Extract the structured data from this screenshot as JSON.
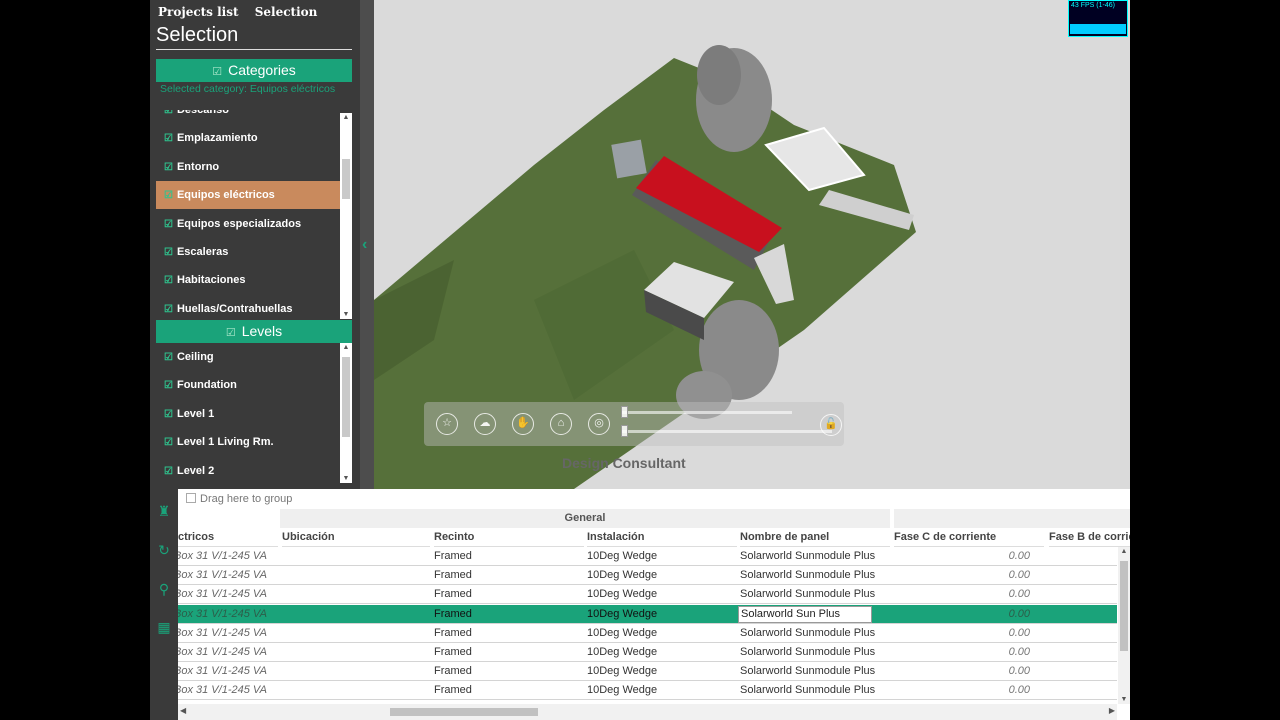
{
  "top_tabs": [
    "Projects list",
    "Selection"
  ],
  "panel_title": "Selection",
  "categories": {
    "header": "Categories",
    "selected_label": "Selected category: Equipos eléctricos",
    "items": [
      {
        "label": "Descanso",
        "active": false
      },
      {
        "label": "Emplazamiento",
        "active": false
      },
      {
        "label": "Entorno",
        "active": false
      },
      {
        "label": "Equipos eléctricos",
        "active": true
      },
      {
        "label": "Equipos especializados",
        "active": false
      },
      {
        "label": "Escaleras",
        "active": false
      },
      {
        "label": "Habitaciones",
        "active": false
      },
      {
        "label": "Huellas/Contrahuellas",
        "active": false
      }
    ]
  },
  "levels": {
    "header": "Levels",
    "items": [
      "Ceiling",
      "Foundation",
      "Level 1",
      "Level 1 Living Rm.",
      "Level 2"
    ]
  },
  "viewport": {
    "watermark": "Design Consultant",
    "fps": "43 FPS (1-46)",
    "nav_buttons": [
      "star-icon",
      "cloud-icon",
      "hand-icon",
      "home-icon",
      "target-icon"
    ],
    "lock_icon": "unlock-icon"
  },
  "grid": {
    "group_hint": "Drag here to group",
    "band_label": "General",
    "columns": [
      "ctricos",
      "Ubicación",
      "Recinto",
      "Instalación",
      "Nombre de panel",
      "Fase C de corriente",
      "Fase B de corrie"
    ],
    "editing_value": "Solarworld Sun Plus",
    "rows": [
      {
        "c0": "Box 31 V/1-245 VA",
        "c1": "",
        "c2": "Framed",
        "c3": "10Deg Wedge",
        "c4": "Solarworld Sunmodule Plus",
        "c5": "0.00",
        "selected": false
      },
      {
        "c0": "Box 31 V/1-245 VA",
        "c1": "",
        "c2": "Framed",
        "c3": "10Deg Wedge",
        "c4": "Solarworld Sunmodule Plus",
        "c5": "0.00",
        "selected": false
      },
      {
        "c0": "Box 31 V/1-245 VA",
        "c1": "",
        "c2": "Framed",
        "c3": "10Deg Wedge",
        "c4": "Solarworld Sunmodule Plus",
        "c5": "0.00",
        "selected": false
      },
      {
        "c0": "Box 31 V/1-245 VA",
        "c1": "",
        "c2": "Framed",
        "c3": "10Deg Wedge",
        "c4": "Solarworld Sun Plus",
        "c5": "0.00",
        "selected": true
      },
      {
        "c0": "Box 31 V/1-245 VA",
        "c1": "",
        "c2": "Framed",
        "c3": "10Deg Wedge",
        "c4": "Solarworld Sunmodule Plus",
        "c5": "0.00",
        "selected": false
      },
      {
        "c0": "Box 31 V/1-245 VA",
        "c1": "",
        "c2": "Framed",
        "c3": "10Deg Wedge",
        "c4": "Solarworld Sunmodule Plus",
        "c5": "0.00",
        "selected": false
      },
      {
        "c0": "Box 31 V/1-245 VA",
        "c1": "",
        "c2": "Framed",
        "c3": "10Deg Wedge",
        "c4": "Solarworld Sunmodule Plus",
        "c5": "0.00",
        "selected": false
      },
      {
        "c0": "Box 31 V/1-245 VA",
        "c1": "",
        "c2": "Framed",
        "c3": "10Deg Wedge",
        "c4": "Solarworld Sunmodule Plus",
        "c5": "0.00",
        "selected": false
      }
    ]
  },
  "side_icons": [
    "broom-icon",
    "refresh-icon",
    "search-icon",
    "table-icon"
  ],
  "colors": {
    "accent": "#1aa37a",
    "active_item": "#c98a5d",
    "panel_bg": "#3a3a3a",
    "roof": "#c8101e",
    "terrain": "#56703a"
  }
}
